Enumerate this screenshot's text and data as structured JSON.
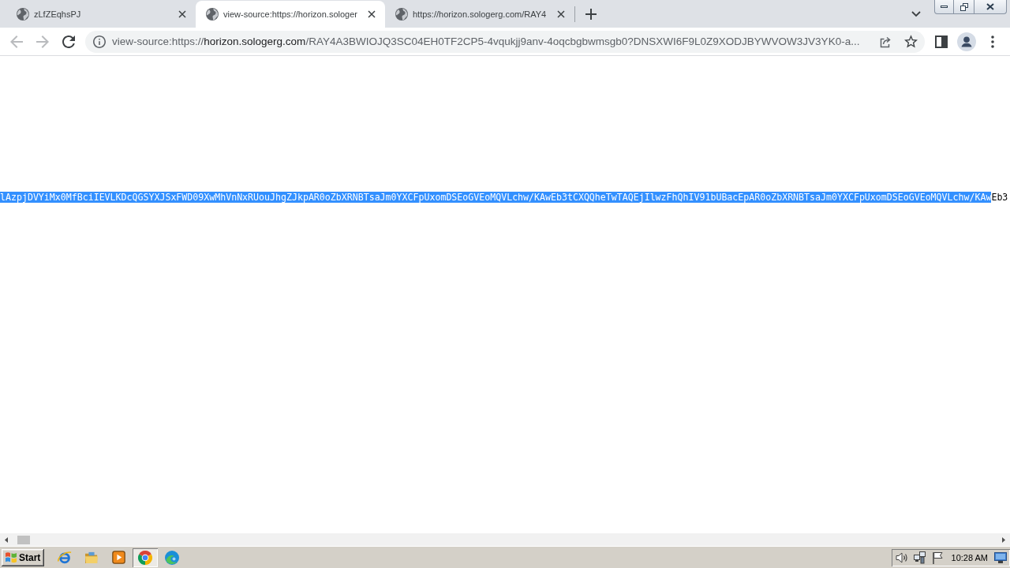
{
  "browser": {
    "tabs": [
      {
        "title": "zLfZEqhsPJ",
        "selected": false
      },
      {
        "title": "view-source:https://horizon.sologer",
        "selected": true
      },
      {
        "title": "https://horizon.sologerg.com/RAY4",
        "selected": false
      }
    ],
    "navigation": [
      {
        "kind": "back",
        "disabled": true
      },
      {
        "kind": "forward",
        "disabled": true
      },
      {
        "kind": "reload",
        "disabled": false
      }
    ],
    "address_bar": {
      "scheme": "view-source:https://",
      "host": "horizon.sologerg.com",
      "path": "/RAY4A3BWIOJQ3SC04EH0TF2CP5-4vqukjj9anv-4oqcbgbwmsgb0?DNSXWI6F9L0Z9XODJBYWVOW3JV3YK0-a..."
    }
  },
  "page": {
    "source_line": [
      {
        "text": "lAzpjDVYiMx0MfBciIEVLKDcQGSYXJSxFWD09XwMhVnNxRUouJhgZJkpAR0oZbXRNBTsaJm0YXCFpUxomDSEoGVEoMQVLchw/KAwEb3tCXQQheTwTAQEjIlwzFhQhIV91bUBacEpAR0oZbXRNBTsaJm0YXCFpUxomDSEoGVEoMQVLchw/KAw",
        "selected": true
      },
      {
        "text": "Eb3",
        "selected": false
      }
    ]
  },
  "taskbar": {
    "start_label": "Start",
    "apps": [
      {
        "kind": "ring_e",
        "active": false
      },
      {
        "kind": "folder",
        "active": false
      },
      {
        "kind": "play",
        "active": false
      },
      {
        "kind": "circle_logo",
        "active": true
      },
      {
        "kind": "swirl",
        "active": false
      }
    ],
    "clock": "10:28 AM"
  }
}
